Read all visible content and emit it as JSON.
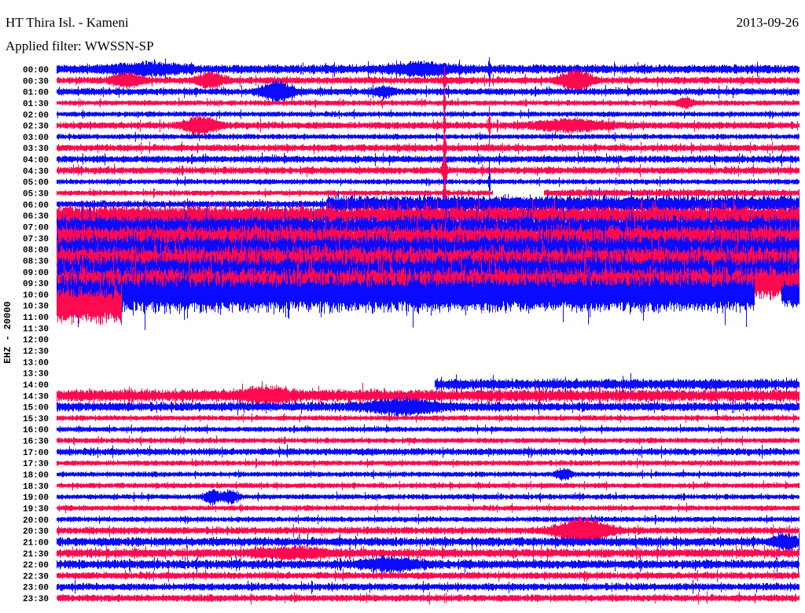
{
  "header": {
    "title": "HT Thira Isl. - Kameni",
    "date": "2013-09-26",
    "filter": "Applied filter: WWSSN-SP"
  },
  "chart_data": {
    "type": "line",
    "title": "HT Thira Isl. - Kameni",
    "subtitle": "Applied filter: WWSSN-SP",
    "ylabel": "EHZ - 20000",
    "row_minutes": 30,
    "colors": {
      "even": "#0a0aff",
      "odd": "#ff0a50"
    },
    "rows": [
      {
        "label": "00:00",
        "segs": [
          [
            0,
            30,
            5
          ]
        ]
      },
      {
        "label": "00:30",
        "segs": [
          [
            0,
            30,
            4
          ]
        ]
      },
      {
        "label": "01:00",
        "segs": [
          [
            0,
            30,
            4
          ]
        ]
      },
      {
        "label": "01:30",
        "segs": [
          [
            0,
            30,
            3
          ]
        ]
      },
      {
        "label": "02:00",
        "segs": [
          [
            0,
            30,
            3
          ]
        ]
      },
      {
        "label": "02:30",
        "segs": [
          [
            0,
            30,
            4
          ]
        ]
      },
      {
        "label": "03:00",
        "segs": [
          [
            0,
            30,
            3
          ]
        ]
      },
      {
        "label": "03:30",
        "segs": [
          [
            0,
            30,
            4
          ]
        ]
      },
      {
        "label": "04:00",
        "segs": [
          [
            0,
            30,
            4
          ]
        ]
      },
      {
        "label": "04:30",
        "segs": [
          [
            0,
            30,
            4
          ]
        ]
      },
      {
        "label": "05:00",
        "segs": [
          [
            0,
            30,
            3
          ]
        ]
      },
      {
        "label": "05:30",
        "segs": [
          [
            0,
            17.6,
            3
          ],
          [
            19.7,
            30,
            4
          ]
        ]
      },
      {
        "label": "06:00",
        "segs": [
          [
            0,
            10.9,
            4
          ],
          [
            10.9,
            30,
            10
          ]
        ]
      },
      {
        "label": "06:30",
        "segs": [
          [
            0,
            30,
            11
          ]
        ]
      },
      {
        "label": "07:00",
        "segs": [
          [
            0,
            30,
            12
          ]
        ]
      },
      {
        "label": "07:30",
        "segs": [
          [
            0,
            30,
            14
          ]
        ]
      },
      {
        "label": "08:00",
        "segs": [
          [
            0,
            30,
            16
          ]
        ]
      },
      {
        "label": "08:30",
        "segs": [
          [
            0,
            30,
            16
          ]
        ]
      },
      {
        "label": "09:00",
        "segs": [
          [
            0,
            30,
            18
          ]
        ]
      },
      {
        "label": "09:30",
        "segs": [
          [
            0,
            30,
            18
          ]
        ]
      },
      {
        "label": "10:00",
        "segs": [
          [
            0,
            28.2,
            20
          ],
          [
            29.3,
            30,
            16
          ]
        ]
      },
      {
        "label": "10:30",
        "segs": [
          [
            0,
            2.6,
            20
          ]
        ]
      },
      {
        "label": "11:00",
        "segs": []
      },
      {
        "label": "11:30",
        "segs": []
      },
      {
        "label": "12:00",
        "segs": []
      },
      {
        "label": "12:30",
        "segs": []
      },
      {
        "label": "13:00",
        "segs": []
      },
      {
        "label": "13:30",
        "segs": []
      },
      {
        "label": "14:00",
        "segs": [
          [
            15.3,
            30,
            6
          ]
        ]
      },
      {
        "label": "14:30",
        "segs": [
          [
            0,
            30,
            7
          ]
        ]
      },
      {
        "label": "15:00",
        "segs": [
          [
            0,
            30,
            5
          ]
        ]
      },
      {
        "label": "15:30",
        "segs": [
          [
            0,
            30,
            3
          ]
        ]
      },
      {
        "label": "16:00",
        "segs": [
          [
            0,
            30,
            3
          ]
        ]
      },
      {
        "label": "16:30",
        "segs": [
          [
            0,
            30,
            3
          ]
        ]
      },
      {
        "label": "17:00",
        "segs": [
          [
            0,
            30,
            4
          ]
        ]
      },
      {
        "label": "17:30",
        "segs": [
          [
            0,
            30,
            3
          ]
        ]
      },
      {
        "label": "18:00",
        "segs": [
          [
            0,
            30,
            3
          ]
        ]
      },
      {
        "label": "18:30",
        "segs": [
          [
            0,
            30,
            3
          ]
        ]
      },
      {
        "label": "19:00",
        "segs": [
          [
            0,
            30,
            3
          ]
        ]
      },
      {
        "label": "19:30",
        "segs": [
          [
            0,
            30,
            3
          ]
        ]
      },
      {
        "label": "20:00",
        "segs": [
          [
            0,
            30,
            3
          ]
        ]
      },
      {
        "label": "20:30",
        "segs": [
          [
            0,
            30,
            4
          ]
        ]
      },
      {
        "label": "21:00",
        "segs": [
          [
            0,
            30,
            5
          ]
        ]
      },
      {
        "label": "21:30",
        "segs": [
          [
            0,
            30,
            5
          ]
        ]
      },
      {
        "label": "22:00",
        "segs": [
          [
            0,
            30,
            5
          ]
        ]
      },
      {
        "label": "22:30",
        "segs": [
          [
            0,
            30,
            4
          ]
        ]
      },
      {
        "label": "23:00",
        "segs": [
          [
            0,
            30,
            4
          ]
        ]
      },
      {
        "label": "23:30",
        "segs": [
          [
            0,
            30,
            4
          ]
        ]
      }
    ],
    "events": [
      [
        0,
        3.6,
        4,
        1.5
      ],
      [
        0,
        14.8,
        5,
        1.2
      ],
      [
        1,
        2.8,
        6,
        0.6
      ],
      [
        1,
        6.2,
        7,
        0.5
      ],
      [
        1,
        21.0,
        10,
        0.6
      ],
      [
        2,
        8.9,
        9,
        0.6
      ],
      [
        2,
        13.2,
        4,
        0.4
      ],
      [
        3,
        25.4,
        5,
        0.3
      ],
      [
        5,
        5.8,
        9,
        0.6
      ],
      [
        5,
        20.8,
        5,
        1.5
      ],
      [
        1,
        15.67,
        14,
        0.04
      ],
      [
        3,
        15.67,
        14,
        0.04
      ],
      [
        5,
        15.67,
        16,
        0.04
      ],
      [
        7,
        15.67,
        18,
        0.05
      ],
      [
        9,
        15.67,
        22,
        0.08
      ],
      [
        11,
        15.67,
        14,
        0.05
      ],
      [
        0,
        17.48,
        16,
        0.03
      ],
      [
        5,
        17.48,
        20,
        0.03
      ],
      [
        10,
        17.48,
        20,
        0.03
      ],
      [
        29,
        8.5,
        5,
        1.0
      ],
      [
        30,
        14.0,
        6,
        1.5
      ],
      [
        38,
        6.3,
        7,
        0.3
      ],
      [
        38,
        7.0,
        6,
        0.3
      ],
      [
        41,
        21.3,
        12,
        1.0
      ],
      [
        42,
        29.5,
        6,
        0.5
      ],
      [
        44,
        13.5,
        5,
        1.2
      ],
      [
        43,
        9.5,
        4,
        1.5
      ],
      [
        36,
        20.5,
        5,
        0.3
      ]
    ]
  }
}
